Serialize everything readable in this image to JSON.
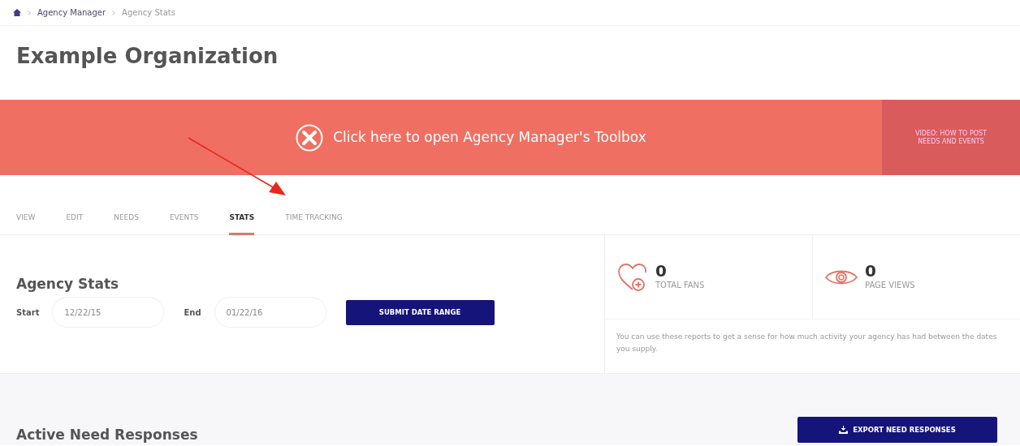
{
  "breadcrumb": [
    {
      "label": "Agency Manager"
    },
    {
      "label": "Agency Stats"
    }
  ],
  "title": "Example Organization",
  "banner": {
    "label": "Click here to open Agency Manager's Toolbox",
    "video_link": "VIDEO: HOW TO POST NEEDS AND EVENTS"
  },
  "tabs": [
    {
      "label": "VIEW",
      "selected": false
    },
    {
      "label": "EDIT",
      "selected": false
    },
    {
      "label": "NEEDS",
      "selected": false
    },
    {
      "label": "EVENTS",
      "selected": false
    },
    {
      "label": "STATS",
      "selected": true
    },
    {
      "label": "TIME TRACKING",
      "selected": false
    }
  ],
  "agency_stats": {
    "heading": "Agency Stats",
    "start_label": "Start",
    "start_value": "12/22/15",
    "end_label": "End",
    "end_value": "01/22/16",
    "submit": "SUBMIT DATE RANGE"
  },
  "metrics": [
    {
      "kind": "fans",
      "value": "0",
      "label": "TOTAL FANS"
    },
    {
      "kind": "views",
      "value": "0",
      "label": "PAGE VIEWS"
    }
  ],
  "description": "You can use these reports to get a sense for how much activity your agency has had between the dates you supply.",
  "active_responses": {
    "heading": "Active Need Responses",
    "export": "EXPORT NEED RESPONSES"
  }
}
